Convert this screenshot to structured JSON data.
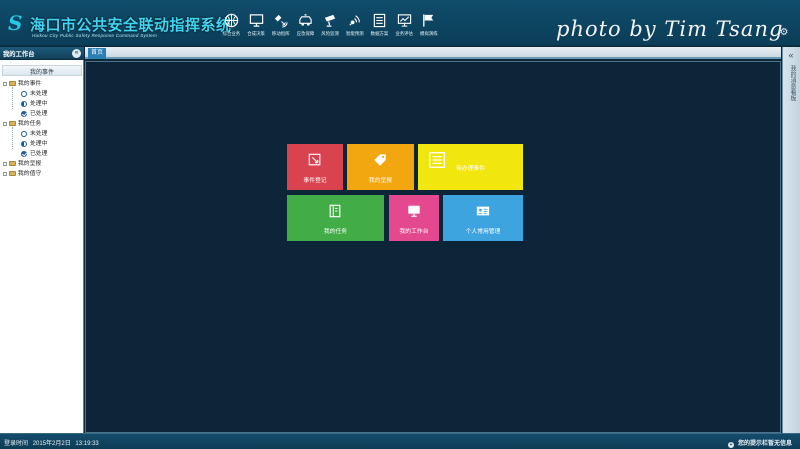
{
  "header": {
    "title": "海口市公共安全联动指挥系统",
    "subtitle": "Haikou City Public Safety Response Command System",
    "watermark": "photo by Tim Tsang",
    "nav": [
      {
        "label": "综合业务",
        "icon": "basketball-icon"
      },
      {
        "label": "合成决策",
        "icon": "monitor-icon"
      },
      {
        "label": "移动指挥",
        "icon": "satellite-icon"
      },
      {
        "label": "应急保障",
        "icon": "vehicle-icon"
      },
      {
        "label": "风险监测",
        "icon": "camera-icon"
      },
      {
        "label": "智能预测",
        "icon": "broadcast-icon"
      },
      {
        "label": "数据方案",
        "icon": "document-icon"
      },
      {
        "label": "业务评估",
        "icon": "chart-icon"
      },
      {
        "label": "模拟演练",
        "icon": "flag-icon"
      }
    ]
  },
  "sidebar": {
    "title": "我的工作台",
    "panel_label": "我的事件",
    "tree": [
      {
        "label": "我的事件",
        "kind": "folder"
      },
      {
        "label": "未处理",
        "kind": "status",
        "state": "empty"
      },
      {
        "label": "处理中",
        "kind": "status",
        "state": "half"
      },
      {
        "label": "已处理",
        "kind": "status",
        "state": "done"
      },
      {
        "label": "我的任务",
        "kind": "folder"
      },
      {
        "label": "未处理",
        "kind": "status",
        "state": "empty"
      },
      {
        "label": "处理中",
        "kind": "status",
        "state": "half"
      },
      {
        "label": "已处理",
        "kind": "status",
        "state": "done"
      },
      {
        "label": "我的呈报",
        "kind": "folder"
      },
      {
        "label": "我的值守",
        "kind": "folder"
      }
    ]
  },
  "tabs": [
    {
      "label": "首页"
    }
  ],
  "tiles": [
    {
      "label": "事件登记",
      "color": "#d9434f",
      "icon": "edit-icon"
    },
    {
      "label": "我的呈报",
      "color": "#f2a60f",
      "icon": "tag-icon"
    },
    {
      "label": "待办理事件",
      "color": "#f2e60f",
      "icon": "list-icon"
    },
    {
      "label": "我的任务",
      "color": "#42ac47",
      "icon": "notebook-icon"
    },
    {
      "label": "我的工作台",
      "color": "#e4498f",
      "icon": "monitor-icon"
    },
    {
      "label": "个人常用管理",
      "color": "#3da4e0",
      "icon": "id-card-icon"
    }
  ],
  "right_panel": {
    "label": "我的消息看板"
  },
  "footer": {
    "login_label": "登录时间",
    "login_date": "2015年2月2日",
    "login_time": "13:19:33",
    "notice": "您的提示栏暂无信息"
  }
}
